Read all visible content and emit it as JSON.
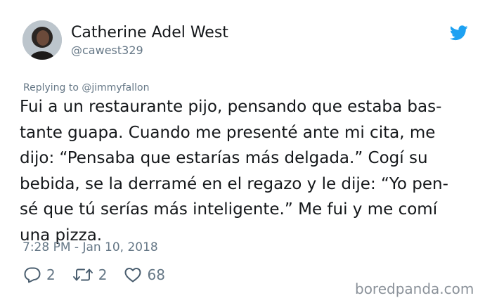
{
  "author": {
    "display_name": "Catherine Adel West",
    "handle": "@cawest329",
    "avatar_icon": "profile-photo"
  },
  "header": {
    "logo_icon": "twitter-bird-icon",
    "logo_color": "#1da1f2"
  },
  "tweet": {
    "reply_to": "Replying to @jimmyfallon",
    "body_lines": [
      "Fui a un restaurante pijo, pensando que estaba bas-",
      "tante guapa. Cuando me presenté ante mi cita, me",
      "dijo: “Pensaba que estarías más delgada.” Cogí su",
      "bebida, se la derramé en el regazo y le dije: “Yo pen-",
      "sé que tú serías más inteligente.” Me fui y me comí",
      "una pizza."
    ],
    "timestamp": "7:28 PM - Jan 10, 2018"
  },
  "actions": {
    "reply": {
      "icon": "reply-icon",
      "count": "2"
    },
    "retweet": {
      "icon": "retweet-icon",
      "count": "2"
    },
    "like": {
      "icon": "heart-icon",
      "count": "68"
    }
  },
  "watermark": {
    "text": "boredpanda.com"
  },
  "colors": {
    "primary_text": "#14171a",
    "secondary_text": "#657786",
    "accent": "#1da1f2"
  }
}
